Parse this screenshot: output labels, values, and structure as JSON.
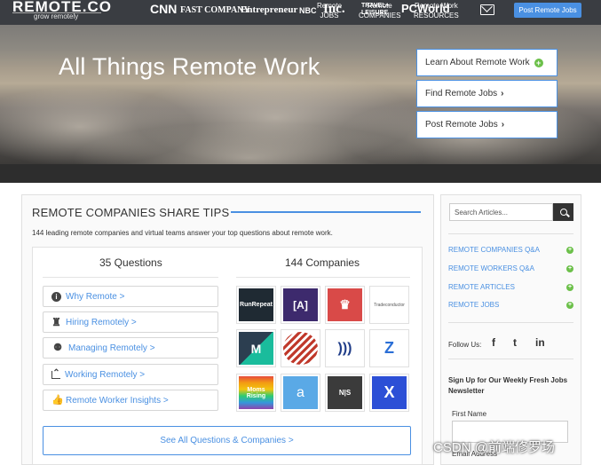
{
  "header": {
    "logo_main": "REMOTE.CO",
    "logo_sub": "grow remotely",
    "nav": [
      {
        "line1": "Remote",
        "line2": "JOBS"
      },
      {
        "line1": "Remote",
        "line2": "COMPANIES"
      },
      {
        "line1": "Remote Work",
        "line2": "RESOURCES"
      }
    ],
    "post_button": "Post Remote Jobs"
  },
  "hero": {
    "title": "All Things Remote Work",
    "buttons": [
      {
        "label": "Learn About Remote Work",
        "icon": "plus-circle-icon"
      },
      {
        "label": "Find Remote Jobs",
        "icon": "chevron-right-icon"
      },
      {
        "label": "Post Remote Jobs",
        "icon": "chevron-right-icon"
      }
    ]
  },
  "press": [
    "CNN",
    "FAST COMPANY",
    "Entrepreneur",
    "NBC",
    "Inc.",
    "TRAVEL+ LEISURE",
    "PCWorld"
  ],
  "main": {
    "title": "REMOTE COMPANIES SHARE TIPS",
    "intro": "144 leading remote companies and virtual teams answer your top questions about remote work.",
    "questions_head": "35 Questions",
    "companies_head": "144 Companies",
    "questions": [
      {
        "label": "Why Remote >",
        "icon": "info-icon"
      },
      {
        "label": "Hiring Remotely >",
        "icon": "person-icon"
      },
      {
        "label": "Managing Remotely >",
        "icon": "group-icon"
      },
      {
        "label": "Working Remotely >",
        "icon": "chart-icon"
      },
      {
        "label": "Remote Worker Insights >",
        "icon": "thumbs-up-icon"
      }
    ],
    "see_all": "See All Questions & Companies >",
    "companies": [
      {
        "name": "RunRepeat",
        "bg": "#1f2a33"
      },
      {
        "name": "[A]",
        "bg": "#3d2a6d"
      },
      {
        "name": "crown",
        "bg": "#d94a48"
      },
      {
        "name": "Tradeconductor",
        "bg": "#ffffff"
      },
      {
        "name": "M",
        "bg": "#2c3e50"
      },
      {
        "name": "stripes",
        "bg": "#ffffff"
      },
      {
        "name": "waves",
        "bg": "#ffffff"
      },
      {
        "name": "Z",
        "bg": "#ffffff"
      },
      {
        "name": "Moms Rising",
        "bg": "#c44"
      },
      {
        "name": "a",
        "bg": "#5aa9e6"
      },
      {
        "name": "N|S",
        "bg": "#3b3b3b"
      },
      {
        "name": "X",
        "bg": "#2c4fd6"
      }
    ]
  },
  "sidebar": {
    "search_placeholder": "Search Articles...",
    "links": [
      "REMOTE COMPANIES Q&A",
      "REMOTE WORKERS Q&A",
      "REMOTE ARTICLES",
      "REMOTE JOBS"
    ],
    "follow_label": "Follow Us:",
    "social": [
      "f",
      "t",
      "in"
    ],
    "signup": "Sign Up for Our Weekly Fresh Jobs Newsletter",
    "first_name": "First Name",
    "email": "Email Address"
  },
  "watermark": "CSDN @前端修罗场",
  "colors": {
    "accent": "#4a90e2",
    "green": "#6cc04a",
    "dark": "#3a3d42"
  }
}
